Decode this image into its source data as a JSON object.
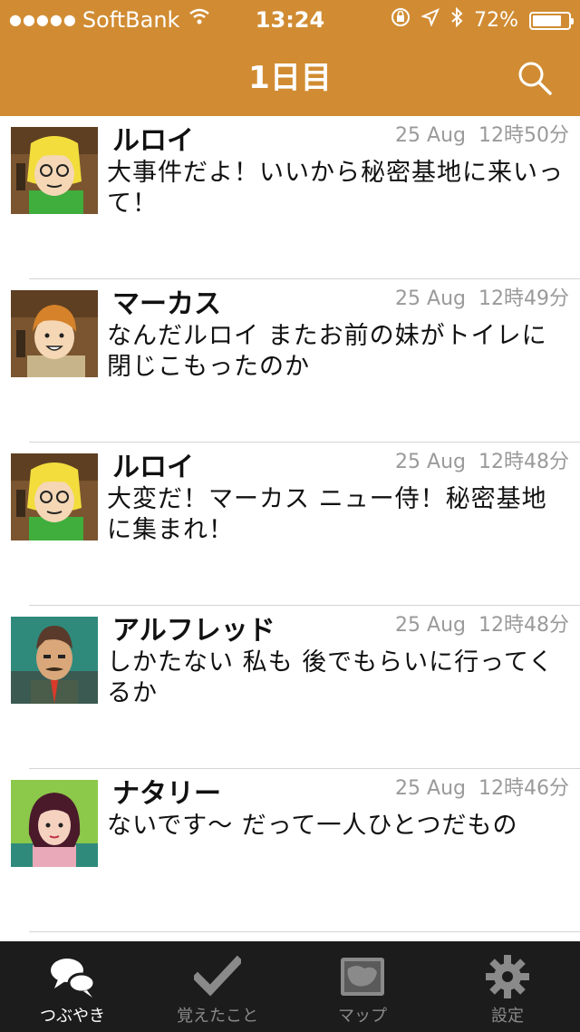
{
  "status_bar": {
    "signal": "●●●●●",
    "carrier": "SoftBank",
    "time": "13:24",
    "battery": "72%",
    "battery_level": 0.72
  },
  "nav": {
    "title": "1日目"
  },
  "feed": [
    {
      "name": "ルロイ",
      "date": "25 Aug",
      "time": "12時50分",
      "message": "大事件だよ！いいから秘密基地に来いって！"
    },
    {
      "name": "マーカス",
      "date": "25 Aug",
      "time": "12時49分",
      "message": "なんだルロイ またお前の妹がトイレに閉じこもったのか"
    },
    {
      "name": "ルロイ",
      "date": "25 Aug",
      "time": "12時48分",
      "message": "大変だ！マーカス ニュー侍！秘密基地に集まれ！"
    },
    {
      "name": "アルフレッド",
      "date": "25 Aug",
      "time": "12時48分",
      "message": "しかたない 私も 後でもらいに行ってくるか"
    },
    {
      "name": "ナタリー",
      "date": "25 Aug",
      "time": "12時46分",
      "message": "ないです～ だって一人ひとつだもの"
    }
  ],
  "tabs": [
    {
      "label": "つぶやき",
      "icon": "chat-bubbles-icon",
      "active": true
    },
    {
      "label": "覚えたこと",
      "icon": "checkmark-icon",
      "active": false
    },
    {
      "label": "マップ",
      "icon": "map-icon",
      "active": false
    },
    {
      "label": "設定",
      "icon": "gear-icon",
      "active": false
    }
  ],
  "colors": {
    "accent": "#d18c33",
    "tabbar": "#1c1c1c",
    "meta_text": "#9a9a9a"
  }
}
